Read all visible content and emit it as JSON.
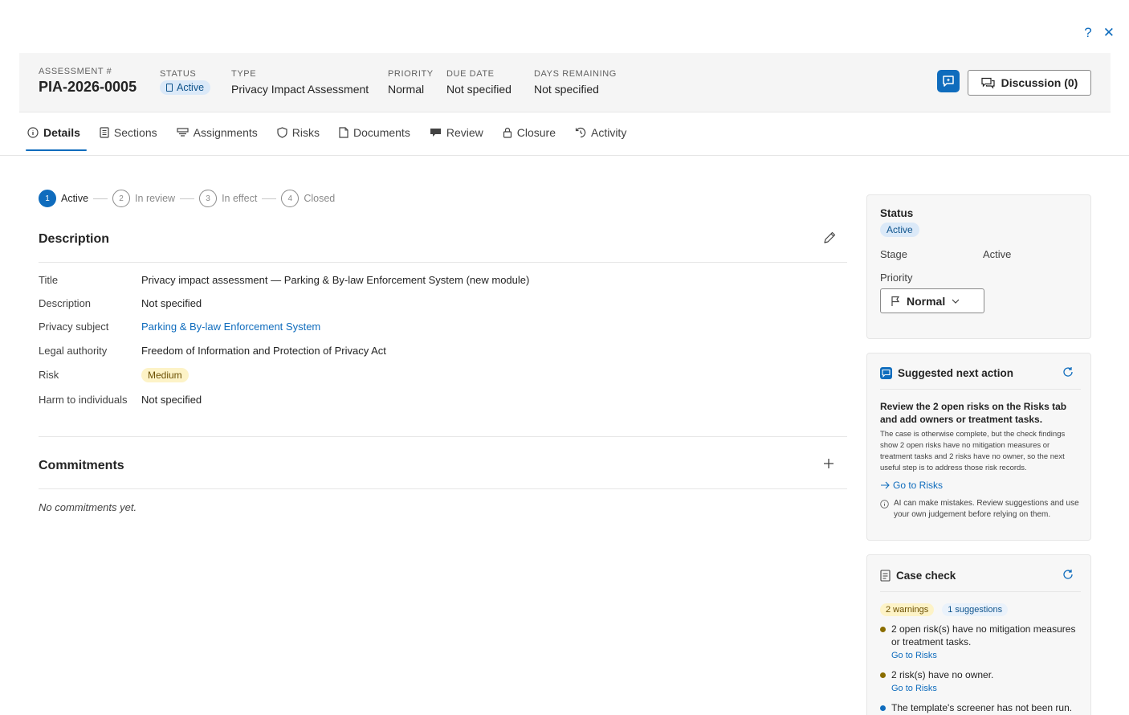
{
  "window": {
    "help_glyph": "?",
    "close_glyph": "✕"
  },
  "header": {
    "assessment_label": "ASSESSMENT #",
    "assessment_value": "PIA-2026-0005",
    "status_label": "STATUS",
    "status_value": "Active",
    "type_label": "TYPE",
    "type_value": "Privacy Impact Assessment",
    "priority_label": "PRIORITY",
    "priority_value": "Normal",
    "due_label": "DUE DATE",
    "due_value": "Not specified",
    "days_label": "DAYS REMAINING",
    "days_value": "Not specified",
    "discussion_label": "Discussion (0)"
  },
  "tabs": [
    {
      "label": "Details",
      "icon": "info-icon"
    },
    {
      "label": "Sections",
      "icon": "list-icon"
    },
    {
      "label": "Assignments",
      "icon": "assign-icon"
    },
    {
      "label": "Risks",
      "icon": "shield-icon"
    },
    {
      "label": "Documents",
      "icon": "document-icon"
    },
    {
      "label": "Review",
      "icon": "review-icon"
    },
    {
      "label": "Closure",
      "icon": "lock-icon"
    },
    {
      "label": "Activity",
      "icon": "history-icon"
    }
  ],
  "stepper": [
    {
      "num": "1",
      "label": "Active"
    },
    {
      "num": "2",
      "label": "In review"
    },
    {
      "num": "3",
      "label": "In effect"
    },
    {
      "num": "4",
      "label": "Closed"
    }
  ],
  "description": {
    "title": "Description",
    "rows": [
      {
        "key": "Title",
        "value": "Privacy impact assessment — Parking & By-law Enforcement System (new module)"
      },
      {
        "key": "Description",
        "value": "Not specified"
      },
      {
        "key": "Privacy subject",
        "value": "Parking & By-law Enforcement System"
      },
      {
        "key": "Legal authority",
        "value": "Freedom of Information and Protection of Privacy Act"
      },
      {
        "key": "Risk",
        "value": "Medium"
      },
      {
        "key": "Harm to individuals",
        "value": "Not specified"
      }
    ]
  },
  "commitments": {
    "title": "Commitments",
    "empty": "No commitments yet."
  },
  "status_card": {
    "title": "Status",
    "status_value": "Active",
    "stage_label": "Stage",
    "stage_value": "Active",
    "priority_label": "Priority",
    "priority_value": "Normal"
  },
  "suggest_card": {
    "title": "Suggested next action",
    "headline": "Review the 2 open risks on the Risks tab and add owners or treatment tasks.",
    "body": "The case is otherwise complete, but the check findings show 2 open risks have no mitigation measures or treatment tasks and 2 risks have no owner, so the next useful step is to address those risk records.",
    "link": "Go to Risks",
    "disclaimer": "AI can make mistakes. Review suggestions and use your own judgement before relying on them."
  },
  "check_card": {
    "title": "Case check",
    "warnings": "2 warnings",
    "suggestions": "1 suggestions",
    "items": [
      {
        "text": "2 open risk(s) have no mitigation measures or treatment tasks.",
        "link": "Go to Risks"
      },
      {
        "text": "2 risk(s) have no owner.",
        "link": "Go to Risks"
      },
      {
        "text": "The template's screener has not been run."
      }
    ]
  },
  "colors": {
    "accent": "#0f6cbd",
    "warning_dot": "#8a6d00",
    "info_dot": "#0f6cbd"
  }
}
